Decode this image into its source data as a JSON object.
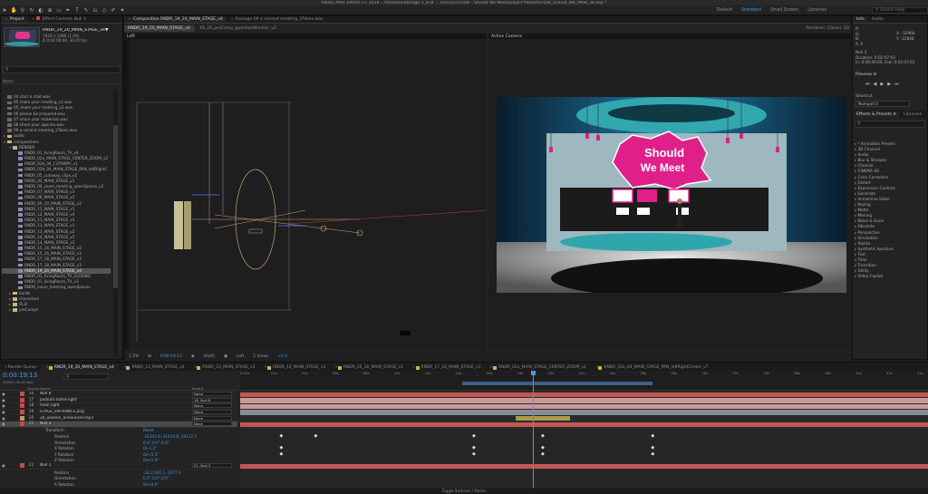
{
  "app": {
    "title": "Adobe After Effects CC 2018 – /Volumes/Storage 3_8TB … ork/2021/FDW – Should We Meet/project files/afx/FDW_Should_We_Meet_v8.aep *",
    "workspaces": [
      "Default",
      "Standard",
      "Small Screen",
      "Libraries"
    ],
    "active_workspace": "Standard",
    "search_placeholder": "Search Help"
  },
  "project_panel": {
    "tabs": [
      "Project",
      "Effect Controls Null 3"
    ],
    "selected_name": "RNDR_19_20_MAIN_STAGE_v4▼",
    "info_line1": "1920 x 1080 (1.00)",
    "info_line2": "Δ 0:02:00:00, 30.00 fps",
    "search_icon": "search-icon",
    "column_header": "Name",
    "items": [
      {
        "indent": 0,
        "type": "file",
        "label": "04 start a chat.wav"
      },
      {
        "indent": 0,
        "type": "file",
        "label": "05 make your meeting_v2.wav"
      },
      {
        "indent": 0,
        "type": "file",
        "label": "05_make your meeting_v2.wav"
      },
      {
        "indent": 0,
        "type": "file",
        "label": "06 please be prepared.wav"
      },
      {
        "indent": 0,
        "type": "file",
        "label": "07 share your materials.wav"
      },
      {
        "indent": 0,
        "type": "file",
        "label": "08 share your agenda.wav"
      },
      {
        "indent": 0,
        "type": "file",
        "label": "09 a second meeting_2Takes.wav"
      },
      {
        "indent": 0,
        "type": "folder",
        "label": "audio"
      },
      {
        "indent": 0,
        "type": "folder",
        "label": "compositions",
        "open": true
      },
      {
        "indent": 1,
        "type": "folder",
        "label": "RENDER",
        "open": true
      },
      {
        "indent": 2,
        "type": "comp",
        "label": "RNDR_01_livingRoom_TV_v4"
      },
      {
        "indent": 2,
        "type": "comp",
        "label": "RNDR_02a_MAIN_STAGE_CENTER_ZOOM_v2"
      },
      {
        "indent": 2,
        "type": "comp",
        "label": "RNDR_02b_04_CUTAWAY_v1"
      },
      {
        "indent": 2,
        "type": "comp",
        "label": "RNDR_02b_04_MAIN_STAGE_PAN_leftRightC"
      },
      {
        "indent": 2,
        "type": "comp",
        "label": "RNDR_05_cutaway_clips_v2"
      },
      {
        "indent": 2,
        "type": "comp",
        "label": "RNDR_05_MAIN_STAGE_v1"
      },
      {
        "indent": 2,
        "type": "comp",
        "label": "RNDR_06_zoom_meeting_openSpaces_v2"
      },
      {
        "indent": 2,
        "type": "comp",
        "label": "RNDR_07_MAIN_STAGE_v3"
      },
      {
        "indent": 2,
        "type": "comp",
        "label": "RNDR_08_MAIN_STAGE_v1"
      },
      {
        "indent": 2,
        "type": "comp",
        "label": "RNDR_09_10_MAIN_STAGE_v2"
      },
      {
        "indent": 2,
        "type": "comp",
        "label": "RNDR_11_MAIN_STAGE_v1"
      },
      {
        "indent": 2,
        "type": "comp",
        "label": "RNDR_12_MAIN_STAGE_v4"
      },
      {
        "indent": 2,
        "type": "comp",
        "label": "RNDR_13_MAIN_STAGE_v3"
      },
      {
        "indent": 2,
        "type": "comp",
        "label": "RNDR_13_MAIN_STAGE_v1"
      },
      {
        "indent": 2,
        "type": "comp",
        "label": "RNDR_13_MAIN_STAGE_v2"
      },
      {
        "indent": 2,
        "type": "comp",
        "label": "RNDR_14_MAIN_STAGE_v3"
      },
      {
        "indent": 2,
        "type": "comp",
        "label": "RNDR_14_MAIN_STAGE_v2"
      },
      {
        "indent": 2,
        "type": "comp",
        "label": "RNDR_15_16_MAIN_STAGE_v2"
      },
      {
        "indent": 2,
        "type": "comp",
        "label": "RNDR_15_16_MAIN_STAGE_v3"
      },
      {
        "indent": 2,
        "type": "comp",
        "label": "RNDR_17_18_MAIN_STAGE_v3"
      },
      {
        "indent": 2,
        "type": "comp",
        "label": "RNDR_17_18_MAIN_STAGE_v3"
      },
      {
        "indent": 2,
        "type": "comp",
        "label": "RNDR_19_20_MAIN_STAGE_v4",
        "selected": true
      },
      {
        "indent": 2,
        "type": "comp",
        "label": "RNDR_01_livingRoom_TV_CLOSING"
      },
      {
        "indent": 2,
        "type": "comp",
        "label": "RNDR_01_livingRoom_TV_v3"
      },
      {
        "indent": 2,
        "type": "comp",
        "label": "RNDR_zoom_meeting_openSpaces"
      },
      {
        "indent": 1,
        "type": "folder",
        "label": "builds"
      },
      {
        "indent": 1,
        "type": "folder",
        "label": "characters"
      },
      {
        "indent": 1,
        "type": "folder",
        "label": "OLD"
      },
      {
        "indent": 1,
        "type": "folder",
        "label": "preComps"
      }
    ]
  },
  "viewer": {
    "tabs": [
      "Composition RNDR_19_20_MAIN_STAGE_v4",
      "Footage 09 a second meeting_2Takes.wav"
    ],
    "subtabs": [
      "RNDR_19_20_MAIN_STAGE_v4",
      "19_20_preComp_questionMonitor_v3"
    ],
    "renderer": "Renderer:  Classic 3D",
    "left_label": "Left",
    "right_label": "Active Camera",
    "bottom": {
      "zoom": "1.5%",
      "timecode": "0:00:19:13",
      "resolution": "(Half)",
      "view": "Left",
      "views": "2 Views",
      "exposure": "+0.0"
    },
    "sign_text_1": "Should",
    "sign_text_2": "We Meet"
  },
  "right_panels": {
    "info_tab": "Info",
    "audio_tab": "Audio",
    "info_lines": [
      "R:",
      "G:",
      "B:",
      "A: 0"
    ],
    "coords": [
      "X: -32968",
      "Y: -22848"
    ],
    "info_name": "Null 3",
    "info_duration": "Duration: 0:02:07:03",
    "info_inout": "In: 0:00:00:00, Out: 0:02:07:02",
    "preview_label": "Preview ≡",
    "shortcut_label": "Shortcut",
    "shortcut_value": "Numpad 0",
    "effects_tab": "Effects & Presets ≡",
    "libraries_tab": "Libraries",
    "effects": [
      "* Animation Presets",
      "3D Channel",
      "Audio",
      "Blur & Sharpen",
      "Channel",
      "CINEMA 4D",
      "Color Correction",
      "Distort",
      "Expression Controls",
      "Generate",
      "Immersive Video",
      "Keying",
      "Matte",
      "Missing",
      "Noise & Grain",
      "Obsolete",
      "Perspective",
      "Simulation",
      "Stylize",
      "Synthetic Aperture",
      "Text",
      "Time",
      "Transition",
      "Utility",
      "Video Copilot"
    ]
  },
  "timeline": {
    "tabs": [
      {
        "label": "Render Queue",
        "color": "",
        "active": false
      },
      {
        "label": "RNDR_19_20_MAIN_STAGE_v4",
        "color": "#d0b050",
        "active": true
      },
      {
        "label": "RNDR_12_MAIN_STAGE_v4",
        "color": "#d0b050",
        "active": false
      },
      {
        "label": "RNDR_13_MAIN_STAGE_v3",
        "color": "#d0b050",
        "active": false
      },
      {
        "label": "RNDR_14_MAIN_STAGE_v3",
        "color": "#d0b050",
        "active": false
      },
      {
        "label": "RNDR_15_16_MAIN_STAGE_v3",
        "color": "#d0b050",
        "active": false
      },
      {
        "label": "RNDR_17_18_MAIN_STAGE_v3",
        "color": "#d0b050",
        "active": false
      },
      {
        "label": "RNDR_02a_MAIN_STAGE_CENTER_ZOOM_v2",
        "color": "#d0b050",
        "active": false
      },
      {
        "label": "RNDR_02b_04_MAIN_STAGE_PAN_leftRightCenter_v7",
        "color": "#d0b050",
        "active": false
      }
    ],
    "current_time": "0:00:19:13",
    "frame_info": "00583 (30.00 fps)",
    "header": {
      "source": "Source Name",
      "parent": "Parent"
    },
    "ruler": [
      "0:00s",
      "02s",
      "04s",
      "06s",
      "08s",
      "10s",
      "12s",
      "14s",
      "16s",
      "18s",
      "20s",
      "22s",
      "24s",
      "26s",
      "28s",
      "30s",
      "32s",
      "34s",
      "36s",
      "38s",
      "40s",
      "42s",
      "44s"
    ],
    "rows": [
      {
        "kind": "layer",
        "num": "16",
        "color": "#c84a4a",
        "name": "Null 8",
        "parent": "None"
      },
      {
        "kind": "layer",
        "num": "17",
        "color": "#c84a4a",
        "name": "podium name light",
        "parent": "16. Null 8"
      },
      {
        "kind": "layer",
        "num": "18",
        "color": "#c84a4a",
        "name": "main light",
        "parent": "None"
      },
      {
        "kind": "layer",
        "num": "19",
        "color": "#c84a4a",
        "name": "STAGE_ENTRANCE.png",
        "parent": "None"
      },
      {
        "kind": "layer",
        "num": "20",
        "color": "#b8a060",
        "name": "20_unseen_announcer.mp3",
        "parent": "None"
      },
      {
        "kind": "layer",
        "num": "21",
        "color": "#c84a4a",
        "name": "Null 3",
        "parent": "None",
        "selected": true
      },
      {
        "kind": "prop",
        "indent": 1,
        "name": "Transform",
        "value": "Reset"
      },
      {
        "kind": "prop",
        "indent": 2,
        "name": "Position",
        "value": "-16343.6,-31434.8,-19137.7"
      },
      {
        "kind": "prop",
        "indent": 2,
        "name": "Orientation",
        "value": "0.0°,0.0°,0.0°"
      },
      {
        "kind": "prop",
        "indent": 2,
        "name": "X Rotation",
        "value": "0x-1.2°"
      },
      {
        "kind": "prop",
        "indent": 2,
        "name": "Y Rotation",
        "value": "0x+5.5°"
      },
      {
        "kind": "prop",
        "indent": 2,
        "name": "Z Rotation",
        "value": "0x+1.0°"
      },
      {
        "kind": "layer",
        "num": "22",
        "color": "#c84a4a",
        "name": "Null 1",
        "parent": "21. Null 3"
      },
      {
        "kind": "prop",
        "indent": 2,
        "name": "Position",
        "value": "-32,2,941,1,-3577.0"
      },
      {
        "kind": "prop",
        "indent": 2,
        "name": "Orientation",
        "value": "0.0°,0.0°,0.0°"
      },
      {
        "kind": "prop",
        "indent": 2,
        "name": "X Rotation",
        "value": "0x+0.0°"
      }
    ],
    "bars": [
      {
        "row": 0,
        "start": 0.0,
        "end": 1.0,
        "color": "#c35656"
      },
      {
        "row": 1,
        "start": 0.0,
        "end": 1.0,
        "color": "#c99a9a"
      },
      {
        "row": 2,
        "start": 0.0,
        "end": 1.0,
        "color": "#c99a9a"
      },
      {
        "row": 3,
        "start": 0.0,
        "end": 1.0,
        "color": "#8a8a9a"
      },
      {
        "row": 4,
        "start": 0.4,
        "end": 0.48,
        "color": "#a89a4a"
      },
      {
        "row": 5,
        "start": 0.0,
        "end": 1.0,
        "color": "#c35656"
      },
      {
        "row": 12,
        "start": 0.0,
        "end": 1.0,
        "color": "#c35656"
      }
    ],
    "keyframes": [
      {
        "row": 7,
        "t": [
          0.06,
          0.11,
          0.34,
          0.44,
          0.6
        ]
      },
      {
        "row": 9,
        "t": [
          0.06,
          0.34,
          0.44,
          0.6
        ]
      },
      {
        "row": 10,
        "t": [
          0.06,
          0.34,
          0.44,
          0.6
        ]
      }
    ],
    "playhead": 0.425,
    "work_area": [
      0.323,
      0.6
    ],
    "footer": "Toggle Switches / Modes"
  }
}
